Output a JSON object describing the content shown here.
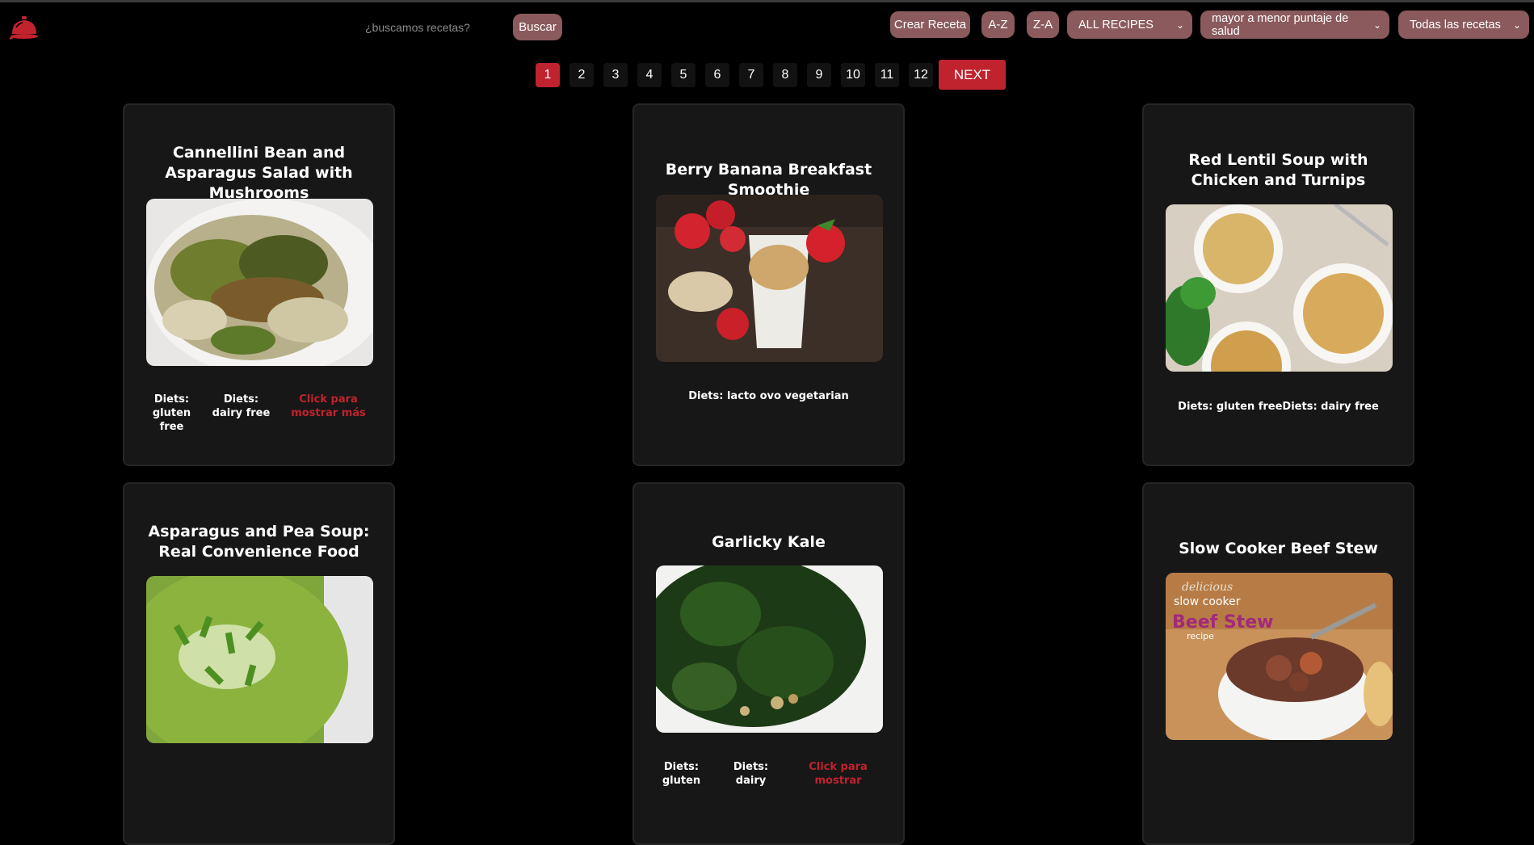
{
  "header": {
    "search_placeholder": "¿buscamos recetas?",
    "search_button": "Buscar",
    "create_button": "Crear Receta",
    "az_button": "A-Z",
    "za_button": "Z-A",
    "diet_filter": "ALL RECIPES",
    "health_sort": "mayor a menor puntaje de salud",
    "source_filter": "Todas las recetas",
    "accent_color": "#c0222e",
    "button_color": "#8a5a5c"
  },
  "pagination": {
    "pages": [
      "1",
      "2",
      "3",
      "4",
      "5",
      "6",
      "7",
      "8",
      "9",
      "10",
      "11",
      "12"
    ],
    "active_page": "1",
    "next_label": "NEXT"
  },
  "show_more_label": "Click para mostrar más",
  "cards": [
    {
      "title": "Cannellini Bean and Asparagus Salad with Mushrooms",
      "diets": [
        "Diets: gluten free",
        "Diets: dairy free"
      ],
      "show_more": true
    },
    {
      "title": "Berry Banana Breakfast Smoothie",
      "diets": [
        "Diets: lacto ovo vegetarian"
      ]
    },
    {
      "title": "Red Lentil Soup with Chicken and Turnips",
      "diets": [
        "Diets: gluten freeDiets: dairy free"
      ]
    },
    {
      "title": "Asparagus and Pea Soup: Real Convenience Food"
    },
    {
      "title": "Garlicky Kale",
      "diets": [
        "Diets: gluten",
        "Diets: dairy"
      ],
      "show_more_partial": "Click para mostrar"
    },
    {
      "title": "Slow Cooker Beef Stew",
      "image_text": [
        "delicious",
        "slow cooker",
        "Beef Stew",
        "recipe"
      ]
    }
  ]
}
